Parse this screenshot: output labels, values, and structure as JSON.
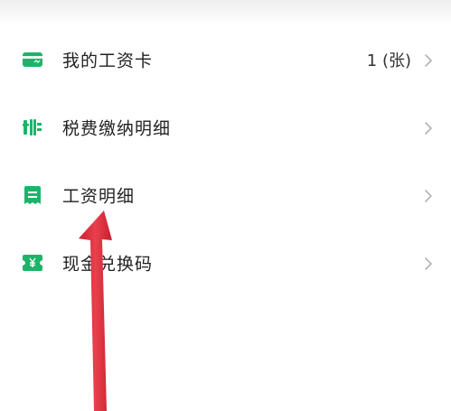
{
  "colors": {
    "icon_green": "#1db46a",
    "annotation_arrow": "#e0323f",
    "chevron": "#b4b4b4"
  },
  "menu": {
    "items": [
      {
        "label": "我的工资卡",
        "value": "1 (张)",
        "icon": "card-icon"
      },
      {
        "label": "税费缴纳明细",
        "value": "",
        "icon": "tax-icon"
      },
      {
        "label": "工资明细",
        "value": "",
        "icon": "receipt-icon"
      },
      {
        "label": "现金兑换码",
        "value": "",
        "icon": "voucher-icon"
      }
    ]
  }
}
